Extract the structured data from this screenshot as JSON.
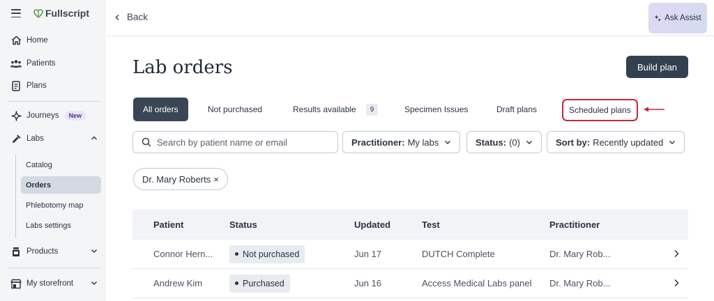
{
  "brand": {
    "name": "Fullscript"
  },
  "sidebar": {
    "items": [
      {
        "label": "Home"
      },
      {
        "label": "Patients"
      },
      {
        "label": "Plans"
      },
      {
        "label": "Journeys",
        "badge": "New"
      },
      {
        "label": "Labs"
      },
      {
        "label": "Products"
      },
      {
        "label": "My storefront"
      }
    ],
    "labs_sub": [
      {
        "label": "Catalog"
      },
      {
        "label": "Orders"
      },
      {
        "label": "Phlebotomy map"
      },
      {
        "label": "Labs settings"
      }
    ]
  },
  "topbar": {
    "back_label": "Back",
    "assist_label": "Ask Assist"
  },
  "page": {
    "title": "Lab orders",
    "build_plan_label": "Build plan"
  },
  "tabs": [
    {
      "label": "All orders"
    },
    {
      "label": "Not purchased"
    },
    {
      "label": "Results available",
      "count": "9"
    },
    {
      "label": "Specimen Issues"
    },
    {
      "label": "Draft plans"
    },
    {
      "label": "Scheduled plans"
    }
  ],
  "filters": {
    "search_placeholder": "Search by patient name or email",
    "practitioner_label": "Practitioner:",
    "practitioner_value": "My labs",
    "status_label": "Status:",
    "status_value": "(0)",
    "sort_label": "Sort by:",
    "sort_value": "Recently updated"
  },
  "chip": {
    "label": "Dr. Mary Roberts",
    "remove": "×"
  },
  "table": {
    "headers": [
      "Patient",
      "Status",
      "Updated",
      "Test",
      "Practitioner"
    ],
    "rows": [
      {
        "patient": "Connor Hern...",
        "status": "Not purchased",
        "updated": "Jun 17",
        "test": "DUTCH Complete",
        "practitioner": "Dr. Mary Rob..."
      },
      {
        "patient": "Andrew Kim",
        "status": "Purchased",
        "updated": "Jun 16",
        "test": "Access Medical Labs panel",
        "practitioner": "Dr. Mary Rob..."
      }
    ]
  },
  "colors": {
    "accent_dark": "#33404f",
    "highlight_red": "#c8263a",
    "sidebar_bg": "#f4f5f7",
    "assist_gradient_start": "#e2d8f4"
  }
}
